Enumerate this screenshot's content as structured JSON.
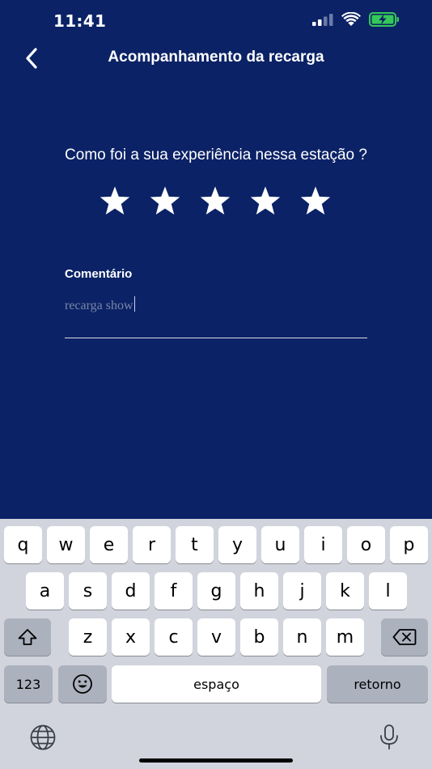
{
  "status_bar": {
    "time": "11:41",
    "icons": [
      "signal-icon",
      "wifi-icon",
      "battery-charging-icon"
    ],
    "battery_color": "#34c759"
  },
  "header": {
    "title": "Acompanhamento da recarga",
    "back_icon": "chevron-left-icon"
  },
  "rating": {
    "question": "Como foi a sua experiência nessa estação ?",
    "stars_total": 5,
    "stars_filled": 5
  },
  "comment": {
    "label": "Comentário",
    "value": "recarga show"
  },
  "keyboard": {
    "row1": [
      "q",
      "w",
      "e",
      "r",
      "t",
      "y",
      "u",
      "i",
      "o",
      "p"
    ],
    "row2": [
      "a",
      "s",
      "d",
      "f",
      "g",
      "h",
      "j",
      "k",
      "l"
    ],
    "row3": [
      "z",
      "x",
      "c",
      "v",
      "b",
      "n",
      "m"
    ],
    "numbers_label": "123",
    "space_label": "espaço",
    "return_label": "retorno",
    "icons": [
      "shift-icon",
      "backspace-icon",
      "emoji-icon",
      "globe-icon",
      "microphone-icon"
    ]
  },
  "colors": {
    "background": "#0b2266",
    "keyboard_background": "#d1d4dc",
    "key": "#ffffff",
    "key_dark": "#abb1bd"
  }
}
